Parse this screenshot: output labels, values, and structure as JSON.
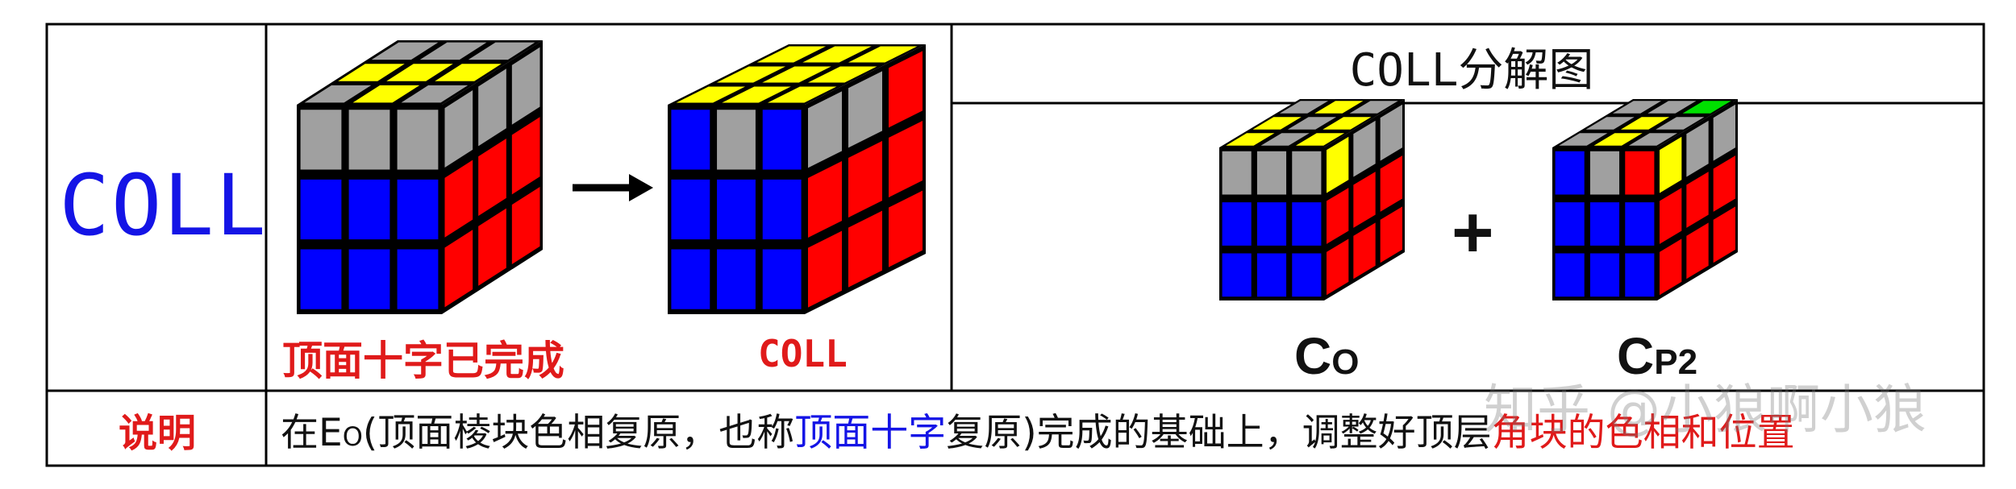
{
  "title": "COLL分解图",
  "row_label": "COLL",
  "arrow_symbol": "→",
  "captions": {
    "cross_done": "顶面十字已完成",
    "coll": "COLL"
  },
  "decomposition": {
    "co_main": "C",
    "co_sub": "O",
    "plus": "+",
    "cp_main": "C",
    "cp_sub": "P2"
  },
  "description": {
    "label": "说明",
    "part1": "在E",
    "part1_sub": "O",
    "part2": "(顶面棱块色相复原，也称",
    "highlight_blue": "顶面十字",
    "part3": "复原)完成的基础上，调整好顶层",
    "highlight_red": "角块的色相和位置"
  },
  "watermark": "知乎 @小狼啊小狼",
  "colors": {
    "gray": "#a0a0a0",
    "yellow": "#ffff00",
    "blue": "#0000ff",
    "red": "#ff0000",
    "green": "#00e000",
    "label_blue": "#1414e6",
    "label_red": "#e01a1a"
  },
  "cubes": {
    "before": {
      "top": [
        "G",
        "G",
        "G",
        "Y",
        "Y",
        "Y",
        "G",
        "Y",
        "G"
      ],
      "front": [
        "G",
        "G",
        "G",
        "B",
        "B",
        "B",
        "B",
        "B",
        "B"
      ],
      "right": [
        "G",
        "G",
        "G",
        "R",
        "R",
        "R",
        "R",
        "R",
        "R"
      ]
    },
    "after": {
      "top": [
        "Y",
        "Y",
        "Y",
        "Y",
        "Y",
        "Y",
        "Y",
        "Y",
        "Y"
      ],
      "front": [
        "B",
        "G",
        "B",
        "B",
        "B",
        "B",
        "B",
        "B",
        "B"
      ],
      "right": [
        "G",
        "G",
        "R",
        "R",
        "R",
        "R",
        "R",
        "R",
        "R"
      ]
    },
    "co": {
      "top": [
        "G",
        "Y",
        "G",
        "Y",
        "G",
        "Y",
        "Y",
        "G",
        "Y"
      ],
      "front": [
        "G",
        "G",
        "G",
        "B",
        "B",
        "B",
        "B",
        "B",
        "B"
      ],
      "right": [
        "Y",
        "G",
        "G",
        "R",
        "R",
        "R",
        "R",
        "R",
        "R"
      ]
    },
    "cp": {
      "top": [
        "G",
        "G",
        "Y",
        "G",
        "Y",
        "G",
        "G",
        "Y",
        "G"
      ],
      "front": [
        "B",
        "G",
        "R",
        "B",
        "B",
        "B",
        "B",
        "B",
        "B"
      ],
      "right": [
        "Y",
        "G",
        "G",
        "R",
        "R",
        "R",
        "R",
        "R",
        "R"
      ]
    }
  }
}
